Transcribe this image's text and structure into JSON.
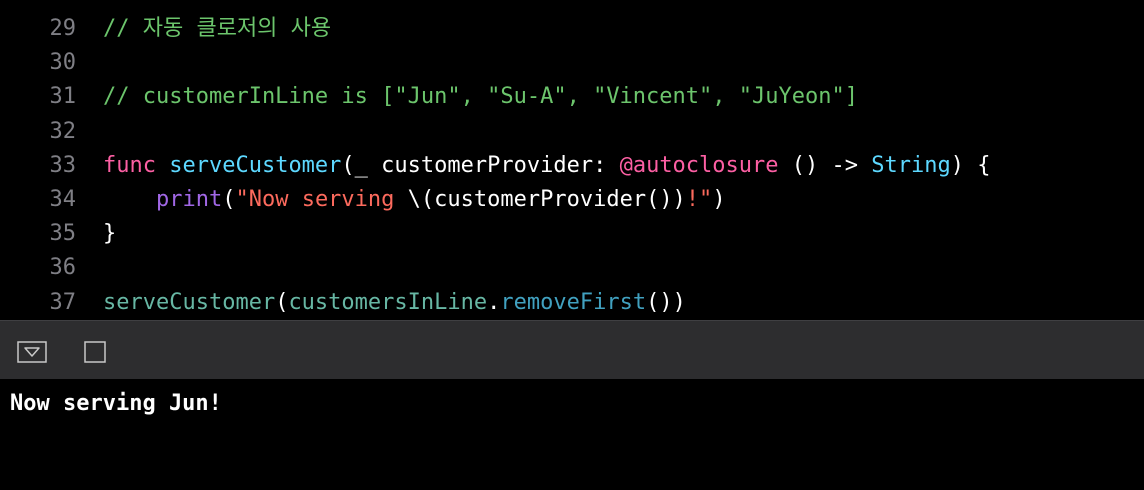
{
  "editor": {
    "lines": [
      {
        "num": "29",
        "tokens": [
          {
            "t": "// 자동 클로저의 사용",
            "c": "comment"
          }
        ]
      },
      {
        "num": "30",
        "tokens": []
      },
      {
        "num": "31",
        "tokens": [
          {
            "t": "// customerInLine is [\"Jun\", \"Su-A\", \"Vincent\", \"JuYeon\"]",
            "c": "comment"
          }
        ]
      },
      {
        "num": "32",
        "tokens": []
      },
      {
        "num": "33",
        "tokens": [
          {
            "t": "func ",
            "c": "keyword"
          },
          {
            "t": "serveCustomer",
            "c": "fn"
          },
          {
            "t": "(_ customerProvider: ",
            "c": "plain"
          },
          {
            "t": "@autoclosure",
            "c": "attr"
          },
          {
            "t": " () -> ",
            "c": "plain"
          },
          {
            "t": "String",
            "c": "type"
          },
          {
            "t": ") {",
            "c": "plain"
          }
        ]
      },
      {
        "num": "34",
        "tokens": [
          {
            "t": "    ",
            "c": "plain"
          },
          {
            "t": "print",
            "c": "call"
          },
          {
            "t": "(",
            "c": "plain"
          },
          {
            "t": "\"Now serving ",
            "c": "string"
          },
          {
            "t": "\\(customerProvider())",
            "c": "plain"
          },
          {
            "t": "!\"",
            "c": "string"
          },
          {
            "t": ")",
            "c": "plain"
          }
        ]
      },
      {
        "num": "35",
        "tokens": [
          {
            "t": "}",
            "c": "plain"
          }
        ]
      },
      {
        "num": "36",
        "tokens": []
      },
      {
        "num": "37",
        "tokens": [
          {
            "t": "serveCustomer",
            "c": "ident"
          },
          {
            "t": "(",
            "c": "plain"
          },
          {
            "t": "customersInLine",
            "c": "ident"
          },
          {
            "t": ".",
            "c": "plain"
          },
          {
            "t": "removeFirst",
            "c": "member"
          },
          {
            "t": "())",
            "c": "plain"
          }
        ]
      }
    ]
  },
  "debug_bar": {
    "hide_icon": "hide-debug-area-icon",
    "clear_icon": "clear-console-icon"
  },
  "console": {
    "output": "Now serving Jun!"
  }
}
